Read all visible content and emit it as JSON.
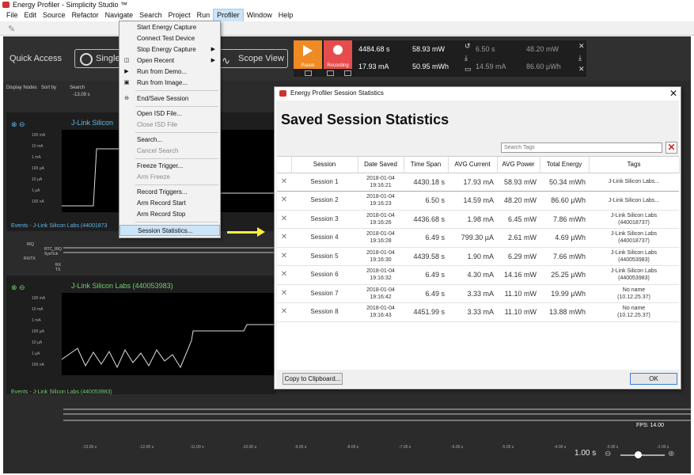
{
  "window": {
    "title": "Energy Profiler - Simplicity Studio ™"
  },
  "menubar": [
    "File",
    "Edit",
    "Source",
    "Refactor",
    "Navigate",
    "Search",
    "Project",
    "Run",
    "Profiler",
    "Window",
    "Help"
  ],
  "app": {
    "quick_access": "Quick Access",
    "single_label": "Single-",
    "scope_view": "Scope View",
    "pause_label": "Pause",
    "recording_label": "Recording",
    "stats": {
      "time": "4484.68 s",
      "power_avg": "58.93 mW",
      "current": "17.93 mA",
      "energy": "50.95 mWh",
      "r1a": "6.50 s",
      "r1b": "48.20 mW",
      "r2a": "14.59 mA",
      "r2b": "86.60 µWh"
    },
    "toolbar": {
      "display_nodes": "Display Nodes",
      "sort_by": "Sort by",
      "search": "Search",
      "time_marker": "-13.09 s"
    },
    "track1": {
      "name": "J-Link Silicon",
      "events": "Events - J-Link Silicon Labs (44001873",
      "yticks": [
        "100 mA",
        "10 mA",
        "1 mA",
        "100 µA",
        "10 µA",
        "1 µA",
        "100 nA"
      ],
      "ylabel": "Current"
    },
    "track2": {
      "name": "J-Link Silicon Labs (440053983)",
      "events": "Events - J-Link Silicon Labs (440053983)",
      "yticks": [
        "100 mA",
        "10 mA",
        "1 mA",
        "100 µA",
        "10 µA",
        "1 µA",
        "100 nA"
      ],
      "ylabel": "Current"
    },
    "event_rows": [
      "IRQ",
      "RTC_IRQ",
      "SysTick",
      "RX/TX",
      "RX",
      "TX"
    ],
    "time_ticks": [
      "-13.09 s",
      "-12.00 s",
      "-11.00 s",
      "-10.00 s",
      "-9.00 s",
      "-8.00 s",
      "-7.00 s",
      "-6.00 s",
      "-5.00 s",
      "-4.00 s",
      "-3.00 s",
      "-2.00 s"
    ],
    "fps": "FPS: 14.00",
    "zoom": "1.00 s"
  },
  "profiler_menu": {
    "items": [
      {
        "label": "Start Energy Capture",
        "enabled": true
      },
      {
        "label": "Connect Test Device",
        "enabled": true
      },
      {
        "label": "Stop Energy Capture",
        "enabled": true,
        "submenu": true
      },
      {
        "label": "Open Recent",
        "enabled": true,
        "submenu": true
      },
      {
        "label": "Run from Demo...",
        "enabled": true
      },
      {
        "label": "Run from Image...",
        "enabled": true
      },
      {
        "label": "End/Save Session",
        "enabled": true
      },
      {
        "label": "Open ISD File...",
        "enabled": true
      },
      {
        "label": "Close ISD File",
        "enabled": false
      },
      {
        "label": "Search...",
        "enabled": true
      },
      {
        "label": "Cancel Search",
        "enabled": false
      },
      {
        "label": "Freeze Trigger...",
        "enabled": true
      },
      {
        "label": "Arm Freeze",
        "enabled": false
      },
      {
        "label": "Record Triggers...",
        "enabled": true
      },
      {
        "label": "Arm Record Start",
        "enabled": true
      },
      {
        "label": "Arm Record Stop",
        "enabled": true
      },
      {
        "label": "Session Statistics...",
        "enabled": true,
        "highlighted": true
      }
    ]
  },
  "dialog": {
    "title": "Energy Profiler Session Statistics",
    "heading": "Saved Session Statistics",
    "search_placeholder": "Search Tags",
    "columns": [
      "",
      "Session",
      "Date Saved",
      "Time Span",
      "AVG Current",
      "AVG Power",
      "Total Energy",
      "Tags"
    ],
    "rows": [
      {
        "session": "Session 1",
        "date": "2018-01-04",
        "time": "19:16:21",
        "span": "4430.18 s",
        "current": "17.93 mA",
        "power": "58.93 mW",
        "energy": "50.34 mWh",
        "tags1": "J-Link Silicon Labs...",
        "tags2": ""
      },
      {
        "session": "Session 2",
        "date": "2018-01-04",
        "time": "19:16:23",
        "span": "6.50 s",
        "current": "14.59 mA",
        "power": "48.20 mW",
        "energy": "86.60 µWh",
        "tags1": "J-Link Silicon Labs...",
        "tags2": ""
      },
      {
        "session": "Session 3",
        "date": "2018-01-04",
        "time": "19:16:26",
        "span": "4436.68 s",
        "current": "1.98 mA",
        "power": "6.45 mW",
        "energy": "7.86 mWh",
        "tags1": "J-Link Silicon Labs",
        "tags2": "(440018737)"
      },
      {
        "session": "Session 4",
        "date": "2018-01-04",
        "time": "19:16:28",
        "span": "6.49 s",
        "current": "799.30 µA",
        "power": "2.61 mW",
        "energy": "4.69 µWh",
        "tags1": "J-Link Silicon Labs",
        "tags2": "(440018737)"
      },
      {
        "session": "Session 5",
        "date": "2018-01-04",
        "time": "19:16:30",
        "span": "4439.58 s",
        "current": "1.90 mA",
        "power": "6.29 mW",
        "energy": "7.66 mWh",
        "tags1": "J-Link Silicon Labs",
        "tags2": "(440053983)"
      },
      {
        "session": "Session 6",
        "date": "2018-01-04",
        "time": "19:16:32",
        "span": "6.49 s",
        "current": "4.30 mA",
        "power": "14.16 mW",
        "energy": "25.25 µWh",
        "tags1": "J-Link Silicon Labs",
        "tags2": "(440053983)"
      },
      {
        "session": "Session 7",
        "date": "2018-01-04",
        "time": "19:16:42",
        "span": "6.49 s",
        "current": "3.33 mA",
        "power": "11.10 mW",
        "energy": "19.99 µWh",
        "tags1": "No name",
        "tags2": "(10.12.25.37)"
      },
      {
        "session": "Session 8",
        "date": "2018-01-04",
        "time": "19:16:43",
        "span": "4451.99 s",
        "current": "3.33 mA",
        "power": "11.10 mW",
        "energy": "13.88 mWh",
        "tags1": "No name",
        "tags2": "(10.12.25.37)"
      }
    ],
    "copy_label": "Copy to Clipboard...",
    "ok_label": "OK"
  }
}
